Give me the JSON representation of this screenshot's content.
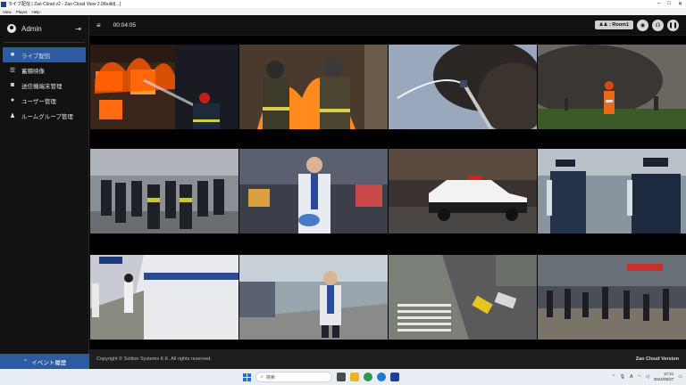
{
  "window": {
    "title": "ライブ配信 | Zao Cloud v2 - Zao Cloud View 2.0/build(...)"
  },
  "menu": {
    "items": [
      "View",
      "Player",
      "Help"
    ]
  },
  "sidebar": {
    "user": "Admin",
    "items": [
      {
        "label": "ライブ配信",
        "icon": "video-camera-icon",
        "active": true
      },
      {
        "label": "蓄積映像",
        "icon": "storage-icon",
        "active": false
      },
      {
        "label": "送信機端末管理",
        "icon": "camera-icon",
        "active": false
      },
      {
        "label": "ユーザー管理",
        "icon": "user-icon",
        "active": false
      },
      {
        "label": "ルームグループ管理",
        "icon": "users-icon",
        "active": false
      }
    ],
    "event_button": "イベント履歴"
  },
  "topbar": {
    "timer": "00:04:05",
    "room": ": Room1"
  },
  "footer": {
    "copyright": "Copyright © Soliton Systems K.K. All rights reserved.",
    "version": "Zao Cloud Version"
  },
  "taskbar": {
    "search_placeholder": "検索",
    "time": "17:21",
    "date": "2024/05/27",
    "ime": "A"
  }
}
